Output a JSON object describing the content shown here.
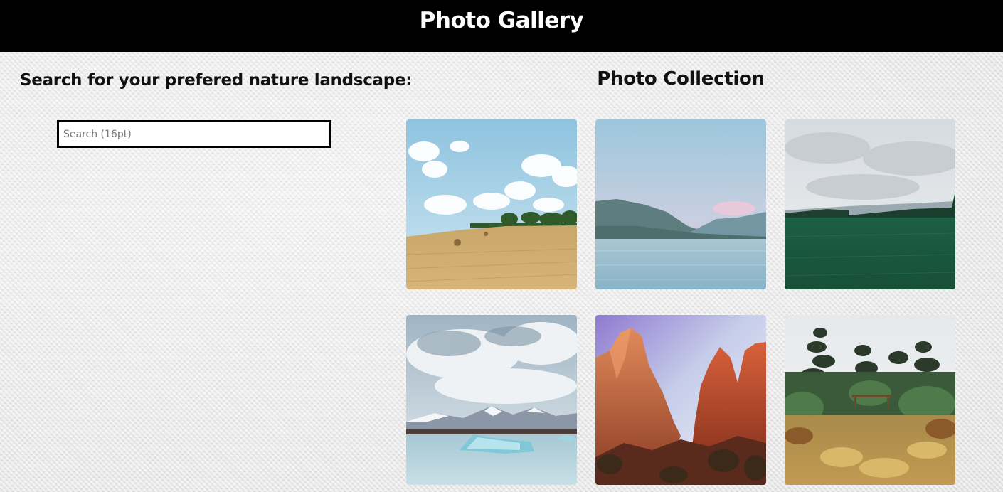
{
  "header": {
    "title": "Photo Gallery"
  },
  "search": {
    "heading": "Search for your prefered nature landscape:",
    "placeholder": "Search (16pt)",
    "value": ""
  },
  "gallery": {
    "heading": "Photo Collection",
    "photos": [
      {
        "subject": "hay field with bales under blue sky with clouds"
      },
      {
        "subject": "calm lake with mountains at dusk"
      },
      {
        "subject": "green meadow under overcast sky"
      },
      {
        "subject": "glacier lagoon with icebergs and snowy mountains"
      },
      {
        "subject": "red rock canyon peaks"
      },
      {
        "subject": "garden path with pine trees and autumn shrubs"
      }
    ]
  }
}
